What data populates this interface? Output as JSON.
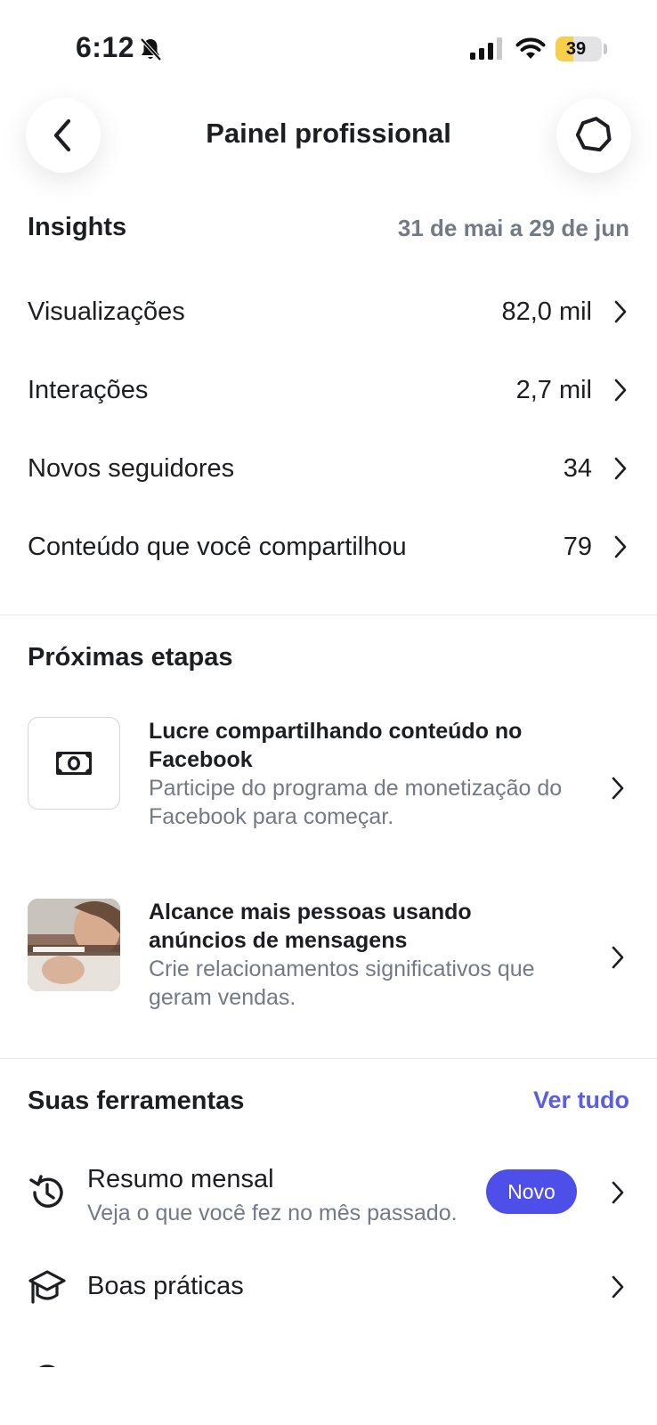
{
  "status_bar": {
    "time": "6:12",
    "battery_level": "39",
    "battery_fraction": 0.39,
    "icons": [
      "bell-slash-icon",
      "cellular-signal-icon",
      "wifi-icon",
      "battery-icon"
    ]
  },
  "header": {
    "title": "Painel profissional",
    "back_icon": "chevron-left-icon",
    "settings_icon": "gear-icon"
  },
  "insights": {
    "heading": "Insights",
    "date_range": "31 de mai a 29 de jun",
    "rows": [
      {
        "label": "Visualizações",
        "value": "82,0 mil"
      },
      {
        "label": "Interações",
        "value": "2,7 mil"
      },
      {
        "label": "Novos seguidores",
        "value": "34"
      },
      {
        "label": "Conteúdo que você compartilhou",
        "value": "79"
      }
    ]
  },
  "next_steps": {
    "heading": "Próximas etapas",
    "items": [
      {
        "title": "Lucre compartilhando conteúdo no Facebook",
        "description": "Participe do programa de monetização do Facebook para começar.",
        "icon": "money-icon"
      },
      {
        "title": "Alcance mais pessoas usando anúncios de mensagens",
        "description": "Crie relacionamentos significativos que geram vendas.",
        "icon": "photo-thumbnail"
      }
    ]
  },
  "tools": {
    "heading": "Suas ferramentas",
    "see_all": "Ver tudo",
    "items": [
      {
        "title": "Resumo mensal",
        "description": "Veja o que você fez no mês passado.",
        "badge": "Novo",
        "icon": "history-icon"
      },
      {
        "title": "Boas práticas",
        "icon": "graduation-cap-icon"
      }
    ]
  },
  "colors": {
    "accent": "#5a5ee0",
    "badge": "#4e4fe8",
    "secondary_text": "#737985",
    "battery": "#f7cf4a"
  }
}
